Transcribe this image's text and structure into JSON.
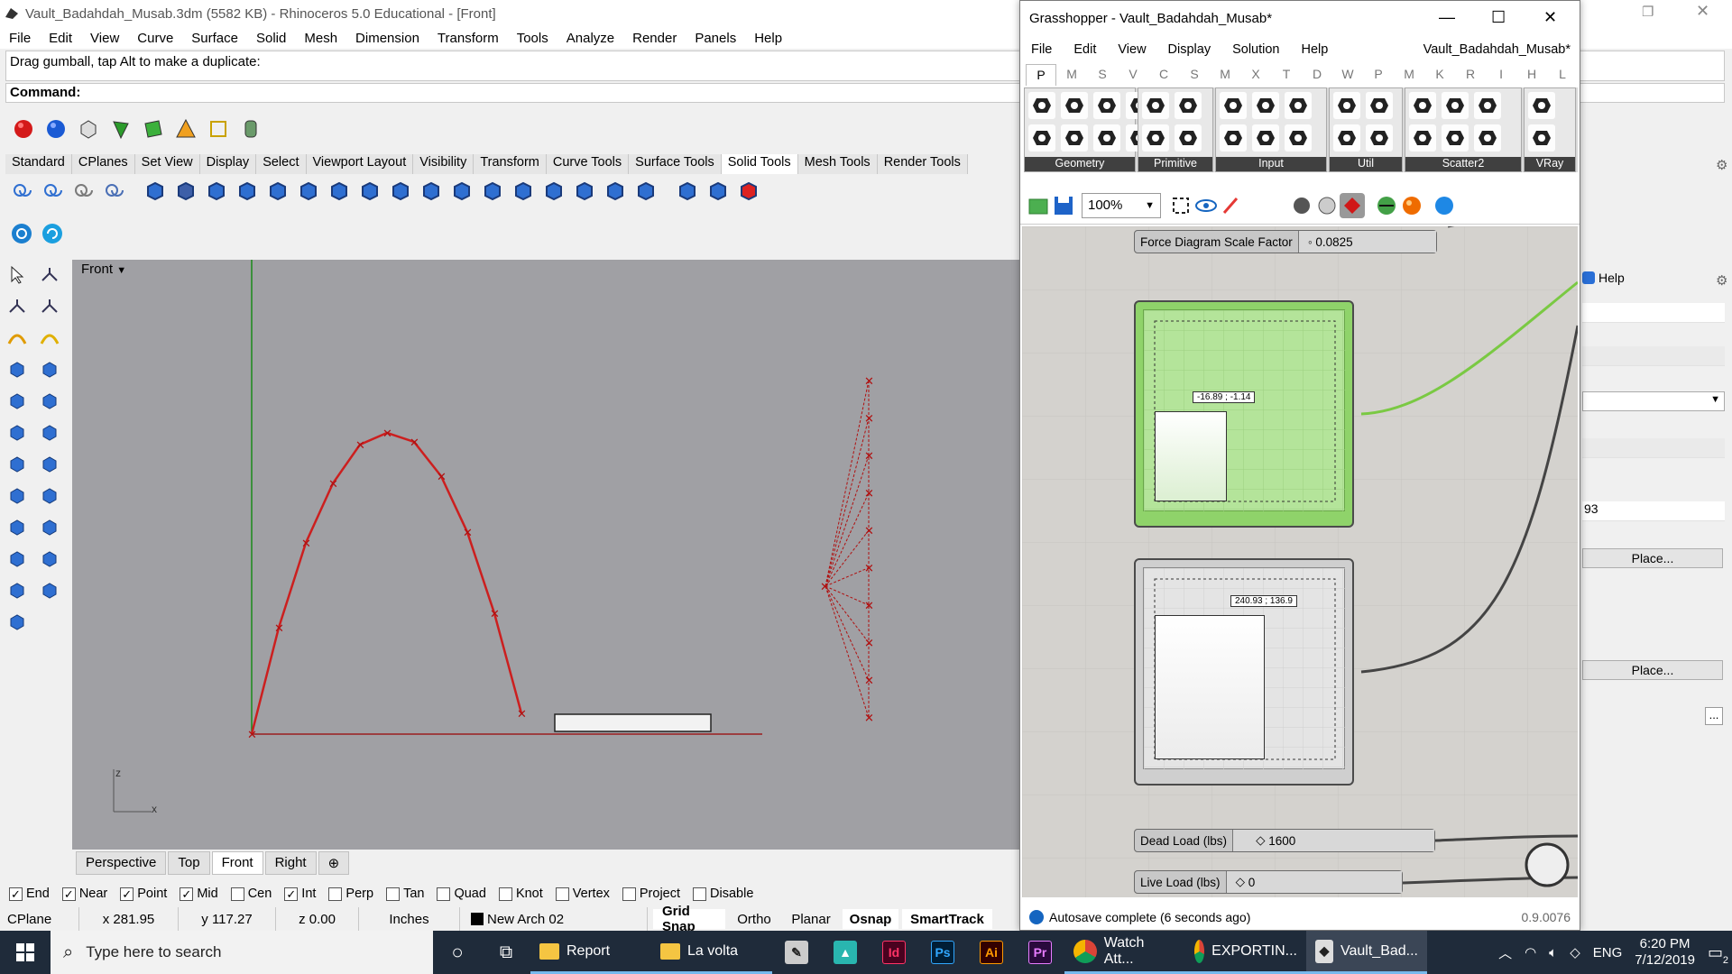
{
  "rhino": {
    "title": "Vault_Badahdah_Musab.3dm (5582 KB) - Rhinoceros 5.0 Educational - [Front]",
    "menu": [
      "File",
      "Edit",
      "View",
      "Curve",
      "Surface",
      "Solid",
      "Mesh",
      "Dimension",
      "Transform",
      "Tools",
      "Analyze",
      "Render",
      "Panels",
      "Help"
    ],
    "command_history": "Drag gumball, tap Alt to make a duplicate:",
    "command_prompt": "Command:",
    "toolbar_tabs": [
      "Standard",
      "CPlanes",
      "Set View",
      "Display",
      "Select",
      "Viewport Layout",
      "Visibility",
      "Transform",
      "Curve Tools",
      "Surface Tools",
      "Solid Tools",
      "Mesh Tools",
      "Render Tools"
    ],
    "active_tab": "Solid Tools",
    "viewport_label": "Front",
    "viewport_tabs": [
      "Perspective",
      "Top",
      "Front",
      "Right"
    ],
    "active_viewport": "Front",
    "axis_z": "z",
    "axis_x": "x",
    "osnaps": [
      {
        "label": "End",
        "checked": true
      },
      {
        "label": "Near",
        "checked": true
      },
      {
        "label": "Point",
        "checked": true
      },
      {
        "label": "Mid",
        "checked": true
      },
      {
        "label": "Cen",
        "checked": false
      },
      {
        "label": "Int",
        "checked": true
      },
      {
        "label": "Perp",
        "checked": false
      },
      {
        "label": "Tan",
        "checked": false
      },
      {
        "label": "Quad",
        "checked": false
      },
      {
        "label": "Knot",
        "checked": false
      },
      {
        "label": "Vertex",
        "checked": false
      },
      {
        "label": "Project",
        "checked": false
      },
      {
        "label": "Disable",
        "checked": false
      }
    ],
    "status": {
      "cplane": "CPlane",
      "x": "x 281.95",
      "y": "y 117.27",
      "z": "z 0.00",
      "units": "Inches",
      "layer": "New Arch 02",
      "layer_color": "#000000",
      "panes": [
        {
          "label": "Grid Snap",
          "on": true
        },
        {
          "label": "Ortho",
          "on": false
        },
        {
          "label": "Planar",
          "on": false
        },
        {
          "label": "Osnap",
          "on": true
        },
        {
          "label": "SmartTrack",
          "on": true
        }
      ]
    }
  },
  "grasshopper": {
    "title": "Grasshopper - Vault_Badahdah_Musab*",
    "menu": [
      "File",
      "Edit",
      "View",
      "Display",
      "Solution",
      "Help"
    ],
    "doc_name": "Vault_Badahdah_Musab*",
    "category_tabs": [
      "P",
      "M",
      "S",
      "V",
      "C",
      "S",
      "M",
      "X",
      "T",
      "D",
      "W",
      "P",
      "M",
      "K",
      "R",
      "I",
      "H",
      "L"
    ],
    "active_category": "P",
    "palette_groups": [
      "Geometry",
      "Primitive",
      "Input",
      "Util",
      "Scatter2",
      "VRay"
    ],
    "zoom": "100%",
    "sliders": [
      {
        "label": "Force Diagram Scale Factor",
        "value": "0.0825"
      },
      {
        "label": "Dead Load (lbs)",
        "value": "1600"
      },
      {
        "label": "Live Load (lbs)",
        "value": "0"
      }
    ],
    "graph1_readout": "-16.89 ; -1.14",
    "graph2_readout": "240.93 ; 136.9",
    "status_text": "Autosave complete (6 seconds ago)",
    "version": "0.9.0076"
  },
  "right_panel": {
    "tab": "Help",
    "value_fragment": "93",
    "place_button_1": "Place...",
    "place_button_2": "Place...",
    "ellipsis": "..."
  },
  "taskbar": {
    "search_placeholder": "Type here to search",
    "items": [
      "Report",
      "La volta",
      "Watch Att...",
      "EXPORTIN...",
      "Vault_Bad..."
    ],
    "apps": [
      "Id",
      "Ps",
      "Ai",
      "Pr"
    ],
    "language": "ENG",
    "time": "6:20 PM",
    "date": "7/12/2019",
    "notification_count": "2"
  },
  "colors": {
    "accent_red": "#cc1f1f",
    "gh_green": "#8fd36a",
    "viewport_bg": "#a0a0a4"
  }
}
